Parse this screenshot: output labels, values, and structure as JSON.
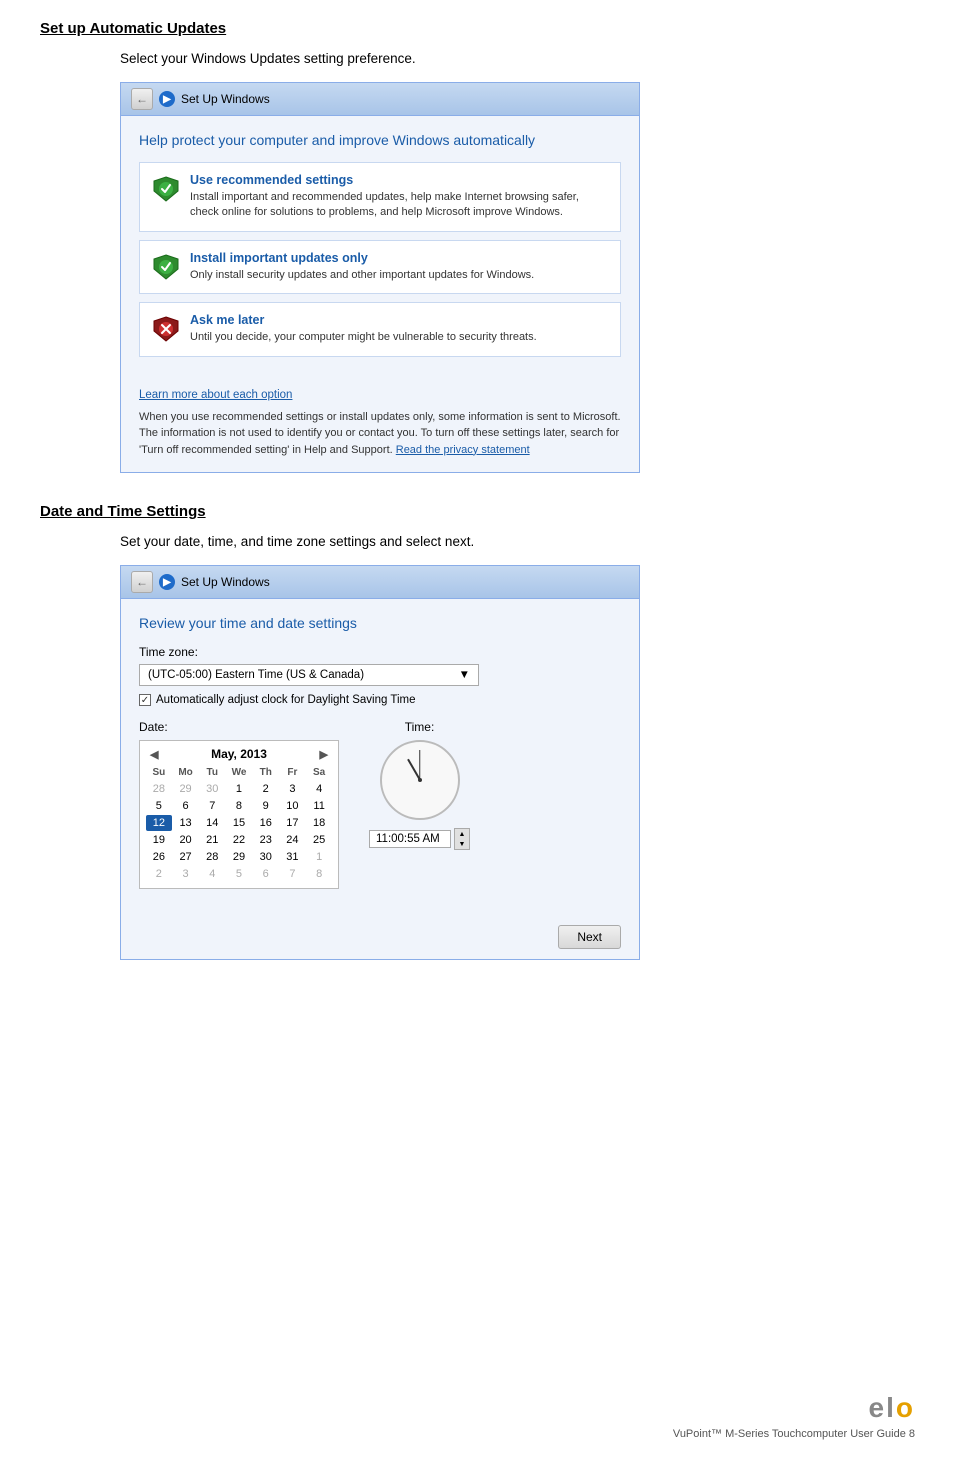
{
  "section1": {
    "heading": "Set up Automatic Updates",
    "intro": "Select your Windows Updates setting preference.",
    "dialog": {
      "titlebar": "Set Up Windows",
      "main_title": "Help protect your computer and improve Windows automatically",
      "options": [
        {
          "type": "green",
          "title": "Use recommended settings",
          "desc": "Install important and recommended updates, help make Internet browsing safer, check online for solutions to problems, and help Microsoft improve Windows."
        },
        {
          "type": "green",
          "title": "Install important updates only",
          "desc": "Only install security updates and other important updates for Windows."
        },
        {
          "type": "red",
          "title": "Ask me later",
          "desc": "Until you decide, your computer might be vulnerable to security threats."
        }
      ],
      "learn_link": "Learn more about each option",
      "footer_text": "When you use recommended settings or install updates only, some information is sent to Microsoft.  The information is not used to identify you or contact you.  To turn off these settings later, search for 'Turn off recommended setting' in Help and Support.",
      "privacy_link": "Read the privacy statement"
    }
  },
  "section2": {
    "heading": "Date and Time Settings",
    "intro": "Set your date, time, and time zone settings and select next.",
    "dialog": {
      "titlebar": "Set Up Windows",
      "main_title": "Review your time and date settings",
      "timezone_label": "Time zone:",
      "timezone_value": "(UTC-05:00) Eastern Time (US & Canada)",
      "dst_checkbox": true,
      "dst_label": "Automatically adjust clock for Daylight Saving Time",
      "date_label": "Date:",
      "time_label": "Time:",
      "calendar": {
        "month": "May, 2013",
        "headers": [
          "Su",
          "Mo",
          "Tu",
          "We",
          "Th",
          "Fr",
          "Sa"
        ],
        "rows": [
          [
            "28",
            "29",
            "30",
            "1",
            "2",
            "3",
            "4"
          ],
          [
            "5",
            "6",
            "7",
            "8",
            "9",
            "10",
            "11"
          ],
          [
            "12",
            "13",
            "14",
            "15",
            "16",
            "17",
            "18"
          ],
          [
            "19",
            "20",
            "21",
            "22",
            "23",
            "24",
            "25"
          ],
          [
            "26",
            "27",
            "28",
            "29",
            "30",
            "31",
            "1"
          ],
          [
            "2",
            "3",
            "4",
            "5",
            "6",
            "7",
            "8"
          ]
        ],
        "selected_day": "12",
        "other_month_start": [
          "28",
          "29",
          "30"
        ],
        "other_month_end_row5": [
          "1"
        ],
        "other_month_end_row6": [
          "2",
          "3",
          "4",
          "5",
          "6",
          "7",
          "8"
        ]
      },
      "time_value": "11:00:55 AM",
      "clock_hour_deg": -30,
      "clock_min_deg": 0,
      "next_label": "Next"
    }
  },
  "brand": {
    "elo_text": "elo",
    "tagline": "VuPoint™  M-Series Touchcomputer User Guide 8"
  }
}
